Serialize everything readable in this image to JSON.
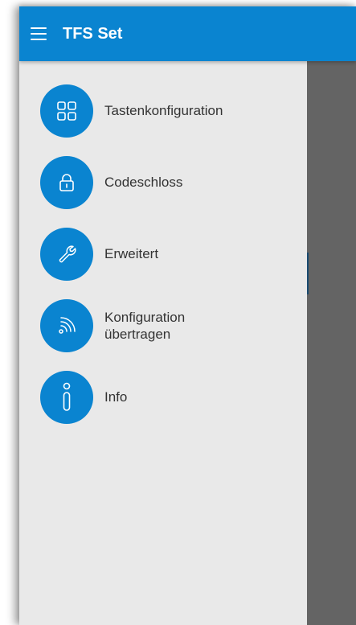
{
  "app": {
    "title": "TFS Set"
  },
  "colors": {
    "primary": "#0a84d0",
    "drawer_bg": "#e9e9e9",
    "scrim": "#646464",
    "text": "#333333"
  },
  "drawer": {
    "items": [
      {
        "label": "Tastenkonfiguration",
        "icon": "grid-icon"
      },
      {
        "label": "Codeschloss",
        "icon": "lock-icon"
      },
      {
        "label": "Erweitert",
        "icon": "wrench-icon"
      },
      {
        "label_line1": "Konfiguration",
        "label_line2": "übertragen",
        "icon": "wireless-transfer-icon"
      },
      {
        "label": "Info",
        "icon": "info-icon"
      }
    ]
  }
}
